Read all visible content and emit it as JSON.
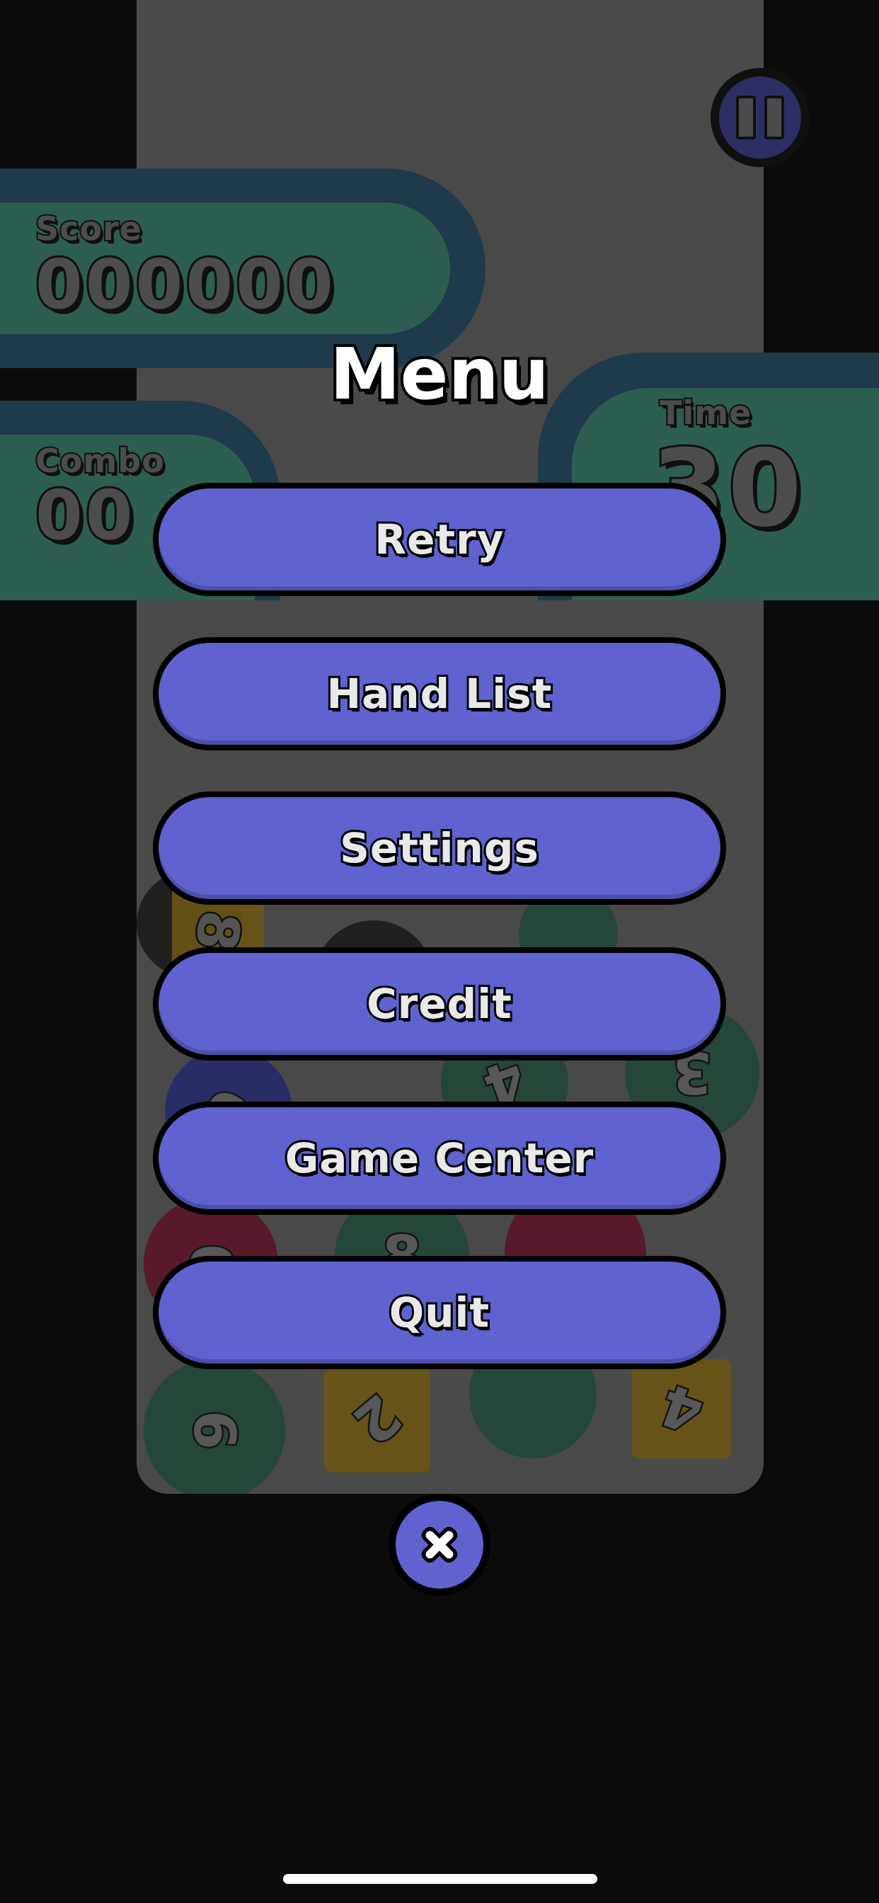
{
  "hud": {
    "score_label": "Score",
    "score_value": "000000",
    "combo_label": "Combo",
    "combo_value": "00",
    "time_label": "Time",
    "time_value": "30"
  },
  "board_tiles": [
    "8",
    "0",
    "4",
    "3",
    "0",
    "8",
    "6",
    "2",
    "4"
  ],
  "menu": {
    "title": "Menu",
    "items": [
      {
        "label": "Retry"
      },
      {
        "label": "Hand List"
      },
      {
        "label": "Settings"
      },
      {
        "label": "Credit"
      },
      {
        "label": "Game Center"
      },
      {
        "label": "Quit"
      }
    ]
  },
  "colors": {
    "button_fill": "#5f62cf",
    "panel_fill": "#2d5e52",
    "panel_border": "#1f3a4a"
  },
  "icons": {
    "pause": "pause-icon",
    "close": "close-icon"
  }
}
